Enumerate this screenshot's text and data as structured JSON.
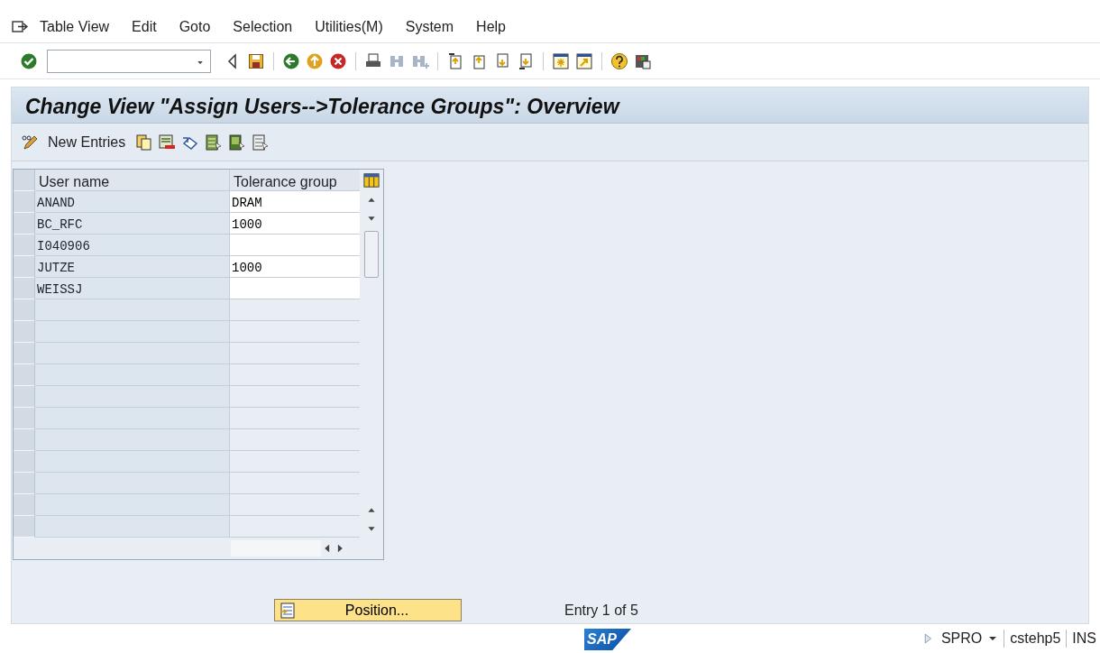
{
  "menu": [
    "Table View",
    "Edit",
    "Goto",
    "Selection",
    "Utilities(M)",
    "System",
    "Help"
  ],
  "screen_title": "Change View \"Assign Users-->Tolerance Groups\": Overview",
  "app_toolbar": {
    "new_entries": "New Entries"
  },
  "table": {
    "columns": [
      "User name",
      "Tolerance group"
    ],
    "rows": [
      {
        "user_name": "ANAND",
        "tolerance_group": "DRAM"
      },
      {
        "user_name": "BC_RFC",
        "tolerance_group": "1000"
      },
      {
        "user_name": "I040906",
        "tolerance_group": ""
      },
      {
        "user_name": "JUTZE",
        "tolerance_group": "1000"
      },
      {
        "user_name": "WEISSJ",
        "tolerance_group": ""
      }
    ]
  },
  "position_button": "Position...",
  "entry_info": "Entry 1 of 5",
  "logo": "SAP",
  "status_bar": {
    "transaction": "SPRO",
    "server": "cstehp5",
    "mode": "INS"
  }
}
